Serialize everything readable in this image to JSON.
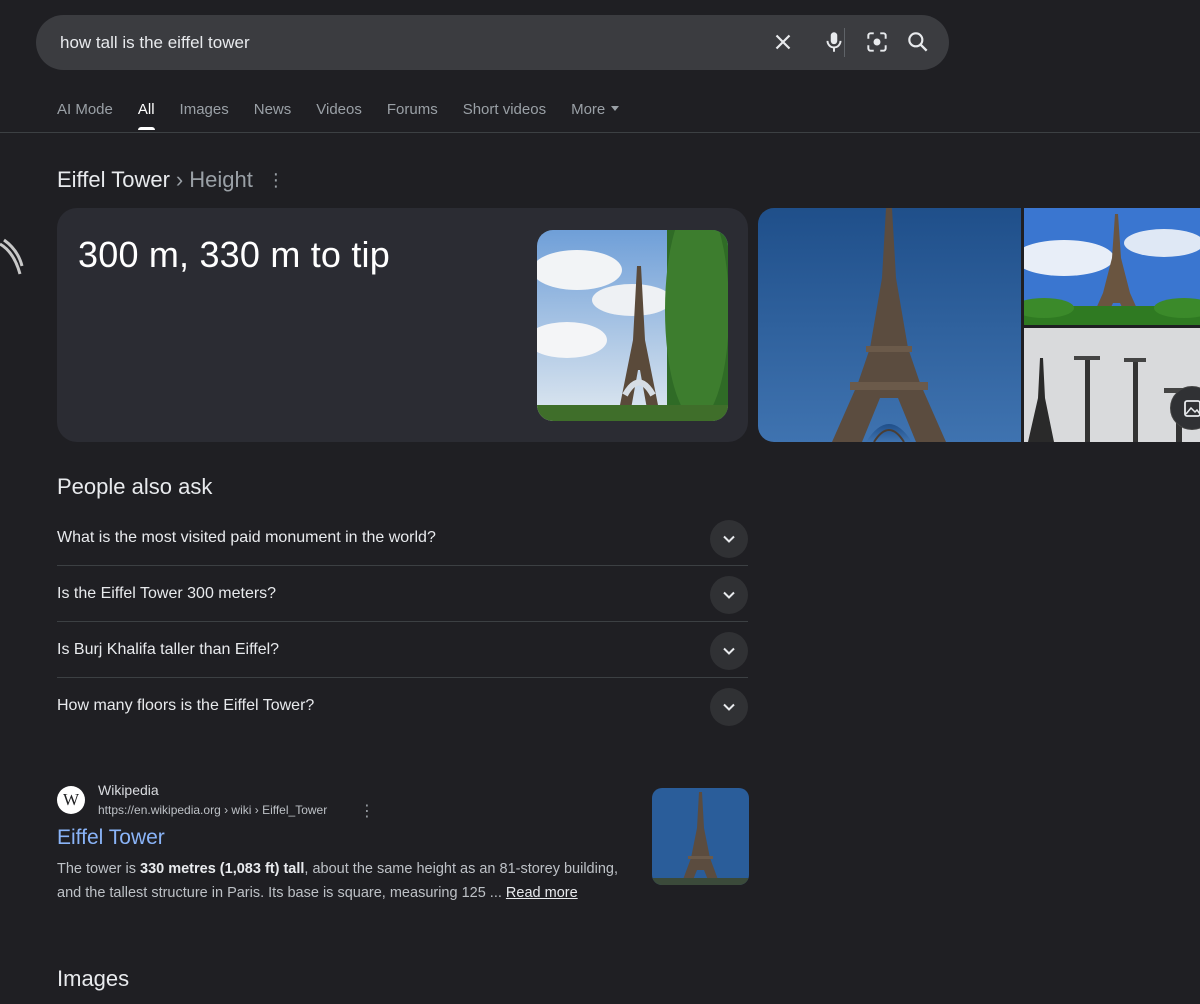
{
  "search": {
    "query": "how tall is the eiffel tower"
  },
  "tabs": [
    {
      "label": "AI Mode"
    },
    {
      "label": "All"
    },
    {
      "label": "Images"
    },
    {
      "label": "News"
    },
    {
      "label": "Videos"
    },
    {
      "label": "Forums"
    },
    {
      "label": "Short videos"
    },
    {
      "label": "More"
    }
  ],
  "knowledge": {
    "entity": "Eiffel Tower",
    "separator": "›",
    "attribute": "Height",
    "answer": "300 m, 330 m to tip"
  },
  "paa": {
    "title": "People also ask",
    "questions": [
      "What is the most visited paid monument in the world?",
      "Is the Eiffel Tower 300 meters?",
      "Is Burj Khalifa taller than Eiffel?",
      "How many floors is the Eiffel Tower?"
    ]
  },
  "result": {
    "favicon_letter": "W",
    "site_name": "Wikipedia",
    "url": "https://en.wikipedia.org › wiki › Eiffel_Tower",
    "title": "Eiffel Tower",
    "snippet_pre": "The tower is ",
    "snippet_bold": "330 metres (1,083 ft) tall",
    "snippet_post": ", about the same height as an 81-storey building, and the tallest structure in Paris. Its base is square, measuring 125 ... ",
    "read_more": "Read more"
  },
  "images_heading": "Images",
  "colors": {
    "background": "#1f1f23",
    "searchbar": "#3b3c40",
    "card": "#2b2c33",
    "link": "#8ab4f8"
  }
}
